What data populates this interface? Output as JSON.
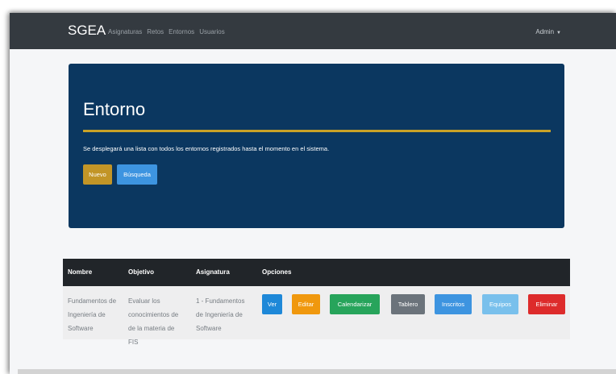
{
  "navbar": {
    "brand": "SGEA",
    "links": [
      "Asignaturas",
      "Retos",
      "Entornos",
      "Usuarios"
    ],
    "user": "Admin"
  },
  "jumbotron": {
    "title": "Entorno",
    "description": "Se desplegará una lista con todos los entornos registrados hasta el momento en el sistema.",
    "new_button": "Nuevo",
    "search_button": "Búsqueda"
  },
  "table": {
    "headers": [
      "Nombre",
      "Objetivo",
      "Asignatura",
      "Opciones"
    ],
    "rows": [
      {
        "nombre": [
          "Fundamentos de",
          "Ingeniería de",
          "Software"
        ],
        "objetivo": [
          "Evaluar los",
          "conocimientos de",
          "de la materia de FIS"
        ],
        "asignatura": [
          "1 - Fundamentos",
          "de Ingeniería de",
          "Software"
        ],
        "actions": [
          "Ver",
          "Editar",
          "Calendarizar",
          "Tablero",
          "Inscritos",
          "Equipos",
          "Eliminar"
        ]
      }
    ]
  },
  "colors": {
    "navbar": "#343a40",
    "jumbotron": "#0b3760",
    "accent_rule": "#c9a227",
    "table_header": "#212529"
  }
}
